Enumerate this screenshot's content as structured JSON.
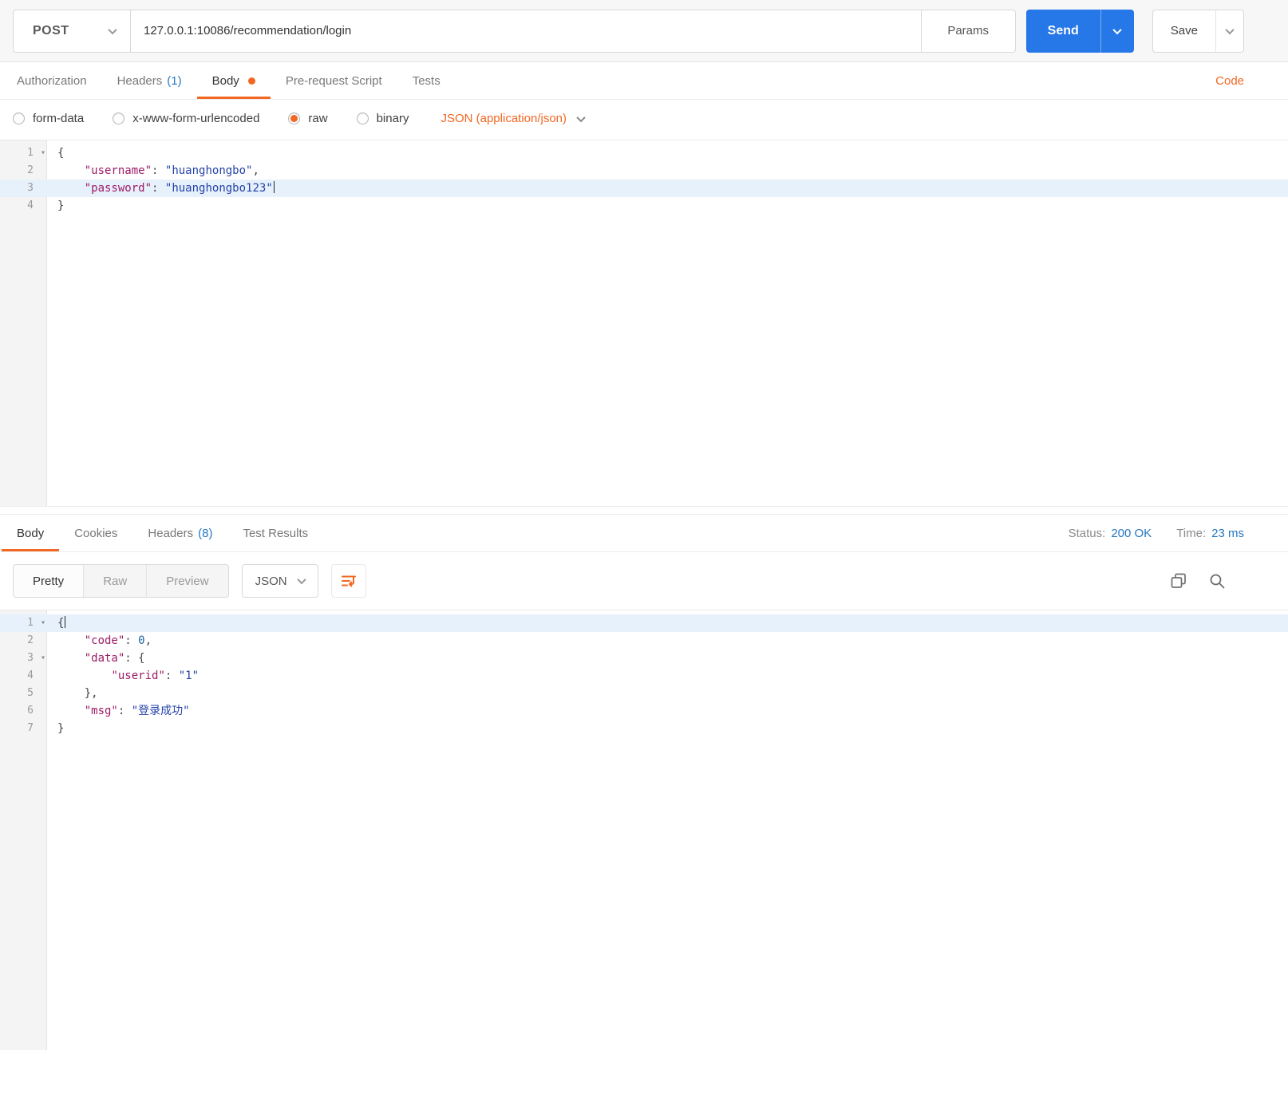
{
  "toolbar": {
    "method": "POST",
    "url": "127.0.0.1:10086/recommendation/login",
    "params": "Params",
    "send": "Send",
    "save": "Save"
  },
  "request_tabs": {
    "authorization": "Authorization",
    "headers": "Headers",
    "headers_count": "(1)",
    "body": "Body",
    "pre_request": "Pre-request Script",
    "tests": "Tests",
    "code": "Code"
  },
  "body_options": {
    "form_data": "form-data",
    "x_www_form_urlencoded": "x-www-form-urlencoded",
    "raw": "raw",
    "binary": "binary",
    "content_type": "JSON (application/json)"
  },
  "request_editor": {
    "lines": [
      {
        "num": 1,
        "fold": true,
        "tokens": [
          {
            "t": "{",
            "c": "punct"
          }
        ]
      },
      {
        "num": 2,
        "tokens": [
          {
            "t": "    ",
            "c": "plain"
          },
          {
            "t": "\"username\"",
            "c": "key"
          },
          {
            "t": ":",
            "c": "punct"
          },
          {
            "t": " ",
            "c": "plain"
          },
          {
            "t": "\"huanghongbo\"",
            "c": "str"
          },
          {
            "t": ",",
            "c": "punct"
          }
        ]
      },
      {
        "num": 3,
        "highlight": true,
        "cursor": true,
        "tokens": [
          {
            "t": "    ",
            "c": "plain"
          },
          {
            "t": "\"password\"",
            "c": "key"
          },
          {
            "t": ":",
            "c": "punct"
          },
          {
            "t": " ",
            "c": "plain"
          },
          {
            "t": "\"huanghongbo123\"",
            "c": "str"
          }
        ]
      },
      {
        "num": 4,
        "tokens": [
          {
            "t": "}",
            "c": "punct"
          }
        ]
      }
    ]
  },
  "response_tabs": {
    "body": "Body",
    "cookies": "Cookies",
    "headers": "Headers",
    "headers_count": "(8)",
    "test_results": "Test Results",
    "status_label": "Status:",
    "status_value": "200 OK",
    "time_label": "Time:",
    "time_value": "23 ms"
  },
  "response_toolbar": {
    "pretty": "Pretty",
    "raw": "Raw",
    "preview": "Preview",
    "language": "JSON"
  },
  "response_editor": {
    "lines": [
      {
        "num": 1,
        "fold": true,
        "highlight": true,
        "cursor": true,
        "tokens": [
          {
            "t": "{",
            "c": "punct"
          }
        ]
      },
      {
        "num": 2,
        "tokens": [
          {
            "t": "    ",
            "c": "plain"
          },
          {
            "t": "\"code\"",
            "c": "key"
          },
          {
            "t": ":",
            "c": "punct"
          },
          {
            "t": " ",
            "c": "plain"
          },
          {
            "t": "0",
            "c": "num"
          },
          {
            "t": ",",
            "c": "punct"
          }
        ]
      },
      {
        "num": 3,
        "fold": true,
        "tokens": [
          {
            "t": "    ",
            "c": "plain"
          },
          {
            "t": "\"data\"",
            "c": "key"
          },
          {
            "t": ":",
            "c": "punct"
          },
          {
            "t": " ",
            "c": "plain"
          },
          {
            "t": "{",
            "c": "punct"
          }
        ]
      },
      {
        "num": 4,
        "tokens": [
          {
            "t": "        ",
            "c": "plain"
          },
          {
            "t": "\"userid\"",
            "c": "key"
          },
          {
            "t": ":",
            "c": "punct"
          },
          {
            "t": " ",
            "c": "plain"
          },
          {
            "t": "\"1\"",
            "c": "str"
          }
        ]
      },
      {
        "num": 5,
        "tokens": [
          {
            "t": "    ",
            "c": "plain"
          },
          {
            "t": "},",
            "c": "punct"
          }
        ]
      },
      {
        "num": 6,
        "tokens": [
          {
            "t": "    ",
            "c": "plain"
          },
          {
            "t": "\"msg\"",
            "c": "key"
          },
          {
            "t": ":",
            "c": "punct"
          },
          {
            "t": " ",
            "c": "plain"
          },
          {
            "t": "\"登录成功\"",
            "c": "str"
          }
        ]
      },
      {
        "num": 7,
        "tokens": [
          {
            "t": "}",
            "c": "punct"
          }
        ]
      }
    ]
  },
  "colors": {
    "accent_orange": "#F26722",
    "send_blue": "#2677E8",
    "link_blue": "#2779C2"
  }
}
